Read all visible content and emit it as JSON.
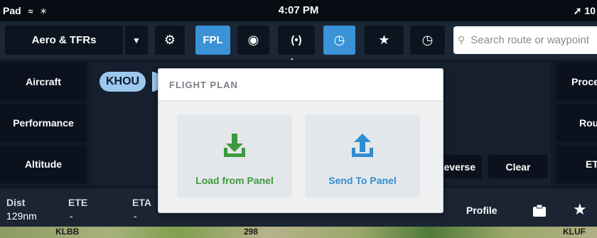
{
  "status": {
    "device": "Pad",
    "time": "4:07 PM",
    "battery": "10"
  },
  "toolbar": {
    "layer": "Aero & TFRs",
    "fpl": "FPL",
    "search_placeholder": "Search route or waypoint"
  },
  "left_buttons": [
    "Aircraft",
    "Performance",
    "Altitude"
  ],
  "right_buttons": [
    "Proce",
    "Rou",
    "ET"
  ],
  "route": {
    "waypoint": "KHOU",
    "reverse": "Reverse",
    "clear": "Clear"
  },
  "info": {
    "dist_label": "Dist",
    "dist_value": "129nm",
    "ete_label": "ETE",
    "ete_value": "-",
    "eta_label": "ETA",
    "eta_value": "-",
    "profile": "Profile"
  },
  "popover": {
    "title": "FLIGHT PLAN",
    "load": "Load from Panel",
    "send": "Send To Panel"
  },
  "map": {
    "labels": [
      "KLBB",
      "298",
      "KLUF"
    ]
  },
  "colors": {
    "accent": "#3a93d6",
    "load_green": "#3c9a3e",
    "send_blue": "#2f8ed2"
  }
}
